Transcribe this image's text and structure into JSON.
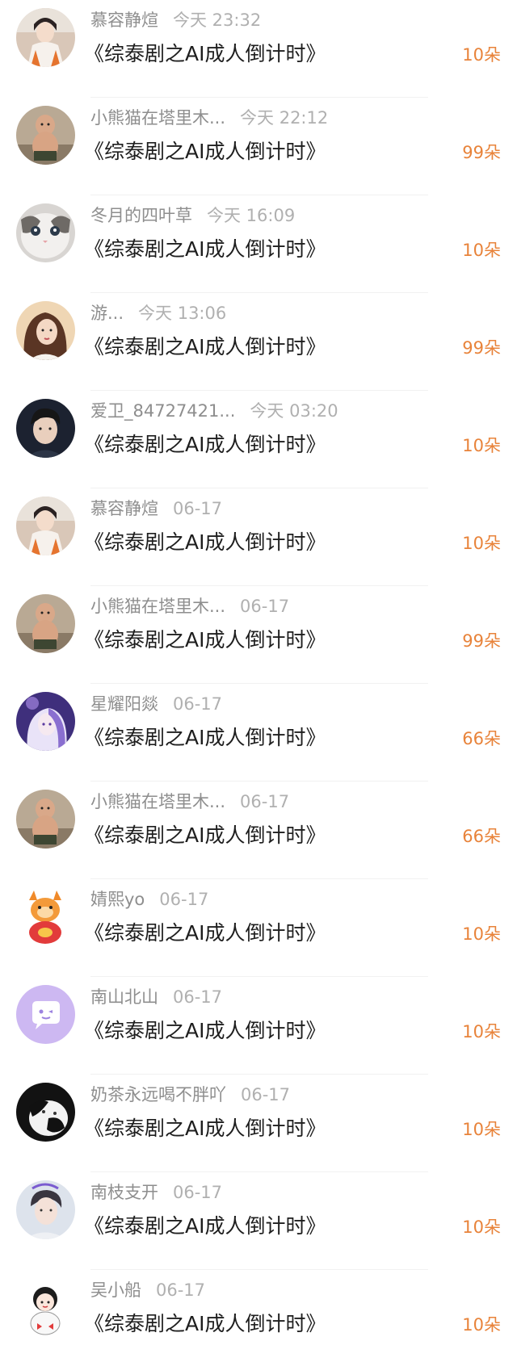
{
  "list": {
    "items": [
      {
        "name": "慕容静煊",
        "time": "今天 23:32",
        "title": "《综泰剧之AI成人倒计时》",
        "count": "10朵",
        "avatar": "girl-hanfu",
        "avatar_color": "#d9c7b8"
      },
      {
        "name": "小熊猫在塔里木...",
        "time": "今天 22:12",
        "title": "《综泰剧之AI成人倒计时》",
        "count": "99朵",
        "avatar": "chubby-kid",
        "avatar_color": "#a89580"
      },
      {
        "name": "冬月的四叶草",
        "time": "今天 16:09",
        "title": "《综泰剧之AI成人倒计时》",
        "count": "10朵",
        "avatar": "cat",
        "avatar_color": "#c6c3c0"
      },
      {
        "name": "游...",
        "time": "今天 13:06",
        "title": "《综泰剧之AI成人倒计时》",
        "count": "99朵",
        "avatar": "girl-portrait",
        "avatar_color": "#e2b48c"
      },
      {
        "name": "爱卫_84727421...",
        "time": "今天 03:20",
        "title": "《综泰剧之AI成人倒计时》",
        "count": "10朵",
        "avatar": "boy-portrait",
        "avatar_color": "#2a3140"
      },
      {
        "name": "慕容静煊",
        "time": "06-17",
        "title": "《综泰剧之AI成人倒计时》",
        "count": "10朵",
        "avatar": "girl-hanfu",
        "avatar_color": "#d9c7b8"
      },
      {
        "name": "小熊猫在塔里木...",
        "time": "06-17",
        "title": "《综泰剧之AI成人倒计时》",
        "count": "99朵",
        "avatar": "chubby-kid",
        "avatar_color": "#a89580"
      },
      {
        "name": "星耀阳燚",
        "time": "06-17",
        "title": "《综泰剧之AI成人倒计时》",
        "count": "66朵",
        "avatar": "anime-purple",
        "avatar_color": "#6b4aa8"
      },
      {
        "name": "小熊猫在塔里木...",
        "time": "06-17",
        "title": "《综泰剧之AI成人倒计时》",
        "count": "66朵",
        "avatar": "chubby-kid",
        "avatar_color": "#a89580"
      },
      {
        "name": "婧熙yo",
        "time": "06-17",
        "title": "《综泰剧之AI成人倒计时》",
        "count": "10朵",
        "avatar": "dragon-sticker",
        "avatar_color": "#f3f0ea"
      },
      {
        "name": "南山北山",
        "time": "06-17",
        "title": "《综泰剧之AI成人倒计时》",
        "count": "10朵",
        "avatar": "chat-bubble",
        "avatar_color": "#cdb8f2"
      },
      {
        "name": "奶茶永远喝不胖吖",
        "time": "06-17",
        "title": "《综泰剧之AI成人倒计时》",
        "count": "10朵",
        "avatar": "black-white-cat",
        "avatar_color": "#1e1e1e"
      },
      {
        "name": "南枝支开",
        "time": "06-17",
        "title": "《综泰剧之AI成人倒计时》",
        "count": "10朵",
        "avatar": "boy-light",
        "avatar_color": "#cfd6e0"
      },
      {
        "name": "吴小船",
        "time": "06-17",
        "title": "《综泰剧之AI成人倒计时》",
        "count": "10朵",
        "avatar": "cartoon-girl-sticker",
        "avatar_color": "#f5f5f5"
      }
    ]
  },
  "colors": {
    "accent": "#e8833a",
    "title_text": "#1e1e1e",
    "meta_text": "#8e8e8e",
    "divider": "#f1f1f1"
  }
}
